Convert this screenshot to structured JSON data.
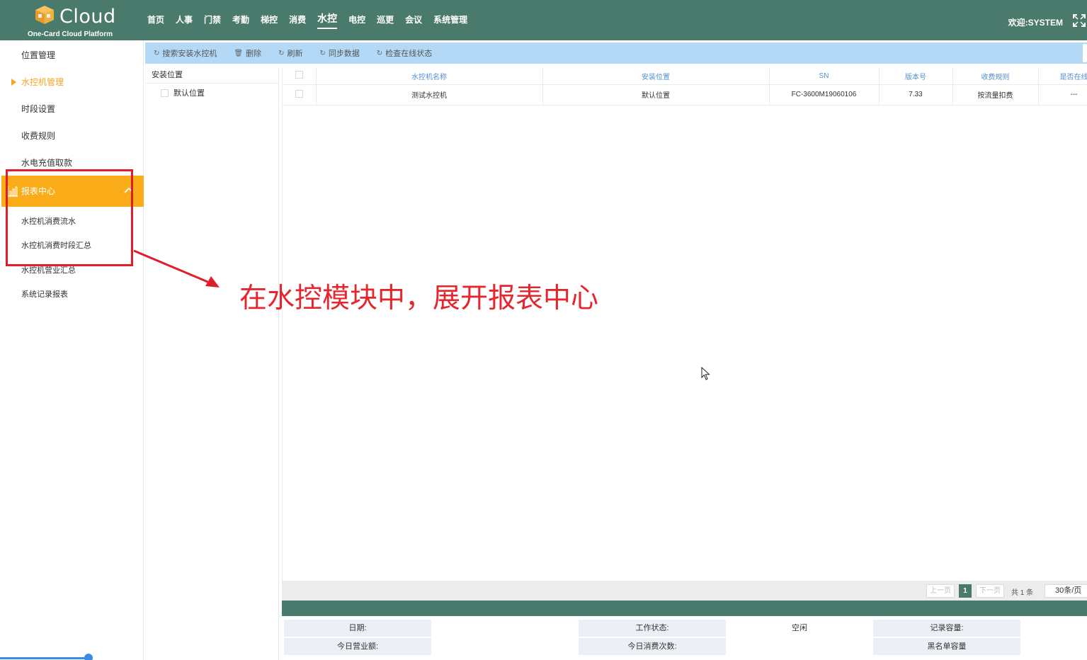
{
  "header": {
    "logo_text": "Cloud",
    "logo_sub": "One-Card Cloud Platform",
    "nav": [
      "首页",
      "人事",
      "门禁",
      "考勤",
      "梯控",
      "消费",
      "水控",
      "电控",
      "巡更",
      "会议",
      "系统管理"
    ],
    "active_nav": "水控",
    "welcome": "欢迎:SYSTEM"
  },
  "sidebar": {
    "items": [
      "位置管理",
      "水控机管理",
      "时段设置",
      "收费规则",
      "水电充值取款"
    ],
    "report_center": "报表中心",
    "report_items": [
      "水控机消费流水",
      "水控机消费时段汇总",
      "水控机营业汇总",
      "系统记录报表"
    ]
  },
  "toolbar": {
    "buttons": [
      "搜索安装水控机",
      "删除",
      "刷新",
      "同步数据",
      "检查在线状态"
    ]
  },
  "tree": {
    "header": "安装位置",
    "nodes": [
      "默认位置"
    ]
  },
  "table": {
    "columns": [
      "水控机名称",
      "安装位置",
      "SN",
      "版本号",
      "收费规则",
      "是否在线"
    ],
    "rows": [
      [
        "测试水控机",
        "默认位置",
        "FC-3600M19060106",
        "7.33",
        "按流量扣费",
        "---"
      ]
    ]
  },
  "pager": {
    "prev": "上一页",
    "current": "1",
    "next": "下一页",
    "total": "共 1 条",
    "page_size": "30条/页"
  },
  "info": {
    "date_label": "日期:",
    "date_value": "",
    "work_status_label": "工作状态:",
    "work_status_value": "空闲",
    "record_capacity_label": "记录容量:",
    "record_capacity_value": "",
    "today_revenue_label": "今日营业额:",
    "today_revenue_value": "",
    "today_count_label": "今日消费次数:",
    "today_count_value": "",
    "blacklist_label": "黑名单容量",
    "blacklist_value": ""
  },
  "annotation": {
    "text": "在水控模块中，展开报表中心"
  },
  "colors": {
    "header": "#4a7a6b",
    "accent_orange": "#fbad19",
    "toolbar": "#b3d9f7",
    "annotation_red": "#e01d2a",
    "column_header_text": "#4f8fd2"
  }
}
